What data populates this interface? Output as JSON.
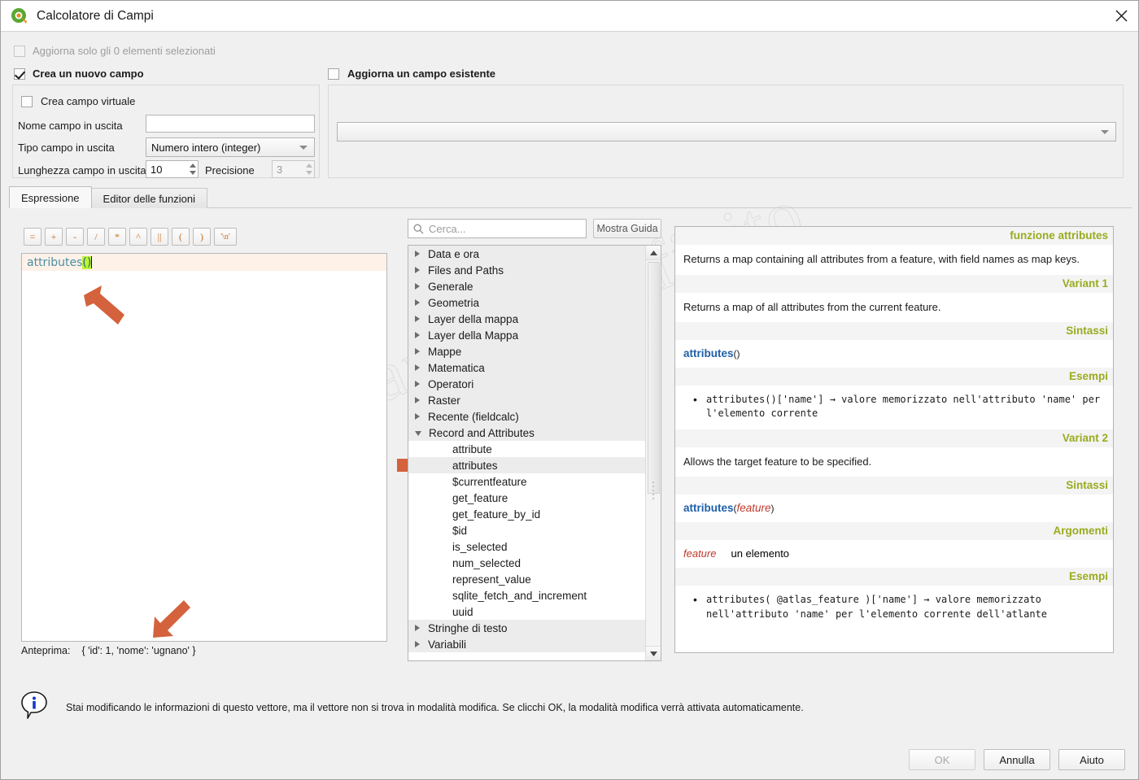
{
  "window": {
    "title": "Calcolatore di Campi",
    "logo_icon": "qgis-logo-icon",
    "close_icon": "close-icon"
  },
  "top": {
    "update_selected_label": "Aggiorna solo gli 0 elementi selezionati",
    "create_new_field_label": "Crea un nuovo campo",
    "update_existing_field_label": "Aggiorna un campo esistente",
    "virtual_field_label": "Crea campo virtuale",
    "output_name_label": "Nome campo in uscita",
    "output_name_value": "",
    "output_type_label": "Tipo campo in uscita",
    "output_type_value": "Numero intero (integer)",
    "output_length_label": "Lunghezza campo in uscita",
    "output_length_value": "10",
    "precision_label": "Precisione",
    "precision_value": "3",
    "existing_field_value": ""
  },
  "tabs": [
    {
      "label": "Espressione",
      "active": true
    },
    {
      "label": "Editor delle funzioni",
      "active": false
    }
  ],
  "operators": [
    "=",
    "+",
    "-",
    "/",
    "*",
    "^",
    "||",
    "(",
    ")",
    "'\\n'"
  ],
  "expression": {
    "function_token": "attributes",
    "open_paren": "( ",
    "close_paren": ")"
  },
  "preview": {
    "label": "Anteprima:",
    "value": "{ 'id': 1, 'nome': 'ugnano' }"
  },
  "search": {
    "placeholder": "Cerca...",
    "value": "",
    "icon": "search-icon",
    "help_button": "Mostra Guida"
  },
  "tree": [
    {
      "label": "Data e ora",
      "type": "group",
      "expanded": false
    },
    {
      "label": "Files and Paths",
      "type": "group",
      "expanded": false
    },
    {
      "label": "Generale",
      "type": "group",
      "expanded": false
    },
    {
      "label": "Geometria",
      "type": "group",
      "expanded": false
    },
    {
      "label": "Layer della mappa",
      "type": "group",
      "expanded": false
    },
    {
      "label": "Layer della Mappa",
      "type": "group",
      "expanded": false
    },
    {
      "label": "Mappe",
      "type": "group",
      "expanded": false
    },
    {
      "label": "Matematica",
      "type": "group",
      "expanded": false
    },
    {
      "label": "Operatori",
      "type": "group",
      "expanded": false
    },
    {
      "label": "Raster",
      "type": "group",
      "expanded": false
    },
    {
      "label": "Recente (fieldcalc)",
      "type": "group",
      "expanded": false
    },
    {
      "label": "Record and Attributes",
      "type": "group",
      "expanded": true
    },
    {
      "label": "attribute",
      "type": "leaf",
      "selected": false
    },
    {
      "label": "attributes",
      "type": "leaf",
      "selected": true
    },
    {
      "label": "$currentfeature",
      "type": "leaf",
      "selected": false
    },
    {
      "label": "get_feature",
      "type": "leaf",
      "selected": false
    },
    {
      "label": "get_feature_by_id",
      "type": "leaf",
      "selected": false
    },
    {
      "label": "$id",
      "type": "leaf",
      "selected": false
    },
    {
      "label": "is_selected",
      "type": "leaf",
      "selected": false
    },
    {
      "label": "num_selected",
      "type": "leaf",
      "selected": false
    },
    {
      "label": "represent_value",
      "type": "leaf",
      "selected": false
    },
    {
      "label": "sqlite_fetch_and_increment",
      "type": "leaf",
      "selected": false
    },
    {
      "label": "uuid",
      "type": "leaf",
      "selected": false
    },
    {
      "label": "Stringhe di testo",
      "type": "group",
      "expanded": false
    },
    {
      "label": "Variabili",
      "type": "group",
      "expanded": false
    }
  ],
  "help": {
    "title": "funzione attributes",
    "intro": "Returns a map containing all attributes from a feature, with field names as map keys.",
    "variant1_head": "Variant 1",
    "variant1_desc": "Returns a map of all attributes from the current feature.",
    "syntax_head": "Sintassi",
    "variant1_syntax_fn": "attributes",
    "variant1_syntax_args": "()",
    "examples_head": "Esempi",
    "variant1_example": "attributes()['name'] → valore memorizzato nell'attributo 'name' per l'elemento corrente",
    "variant2_head": "Variant 2",
    "variant2_desc": "Allows the target feature to be specified.",
    "variant2_syntax_fn": "attributes",
    "variant2_syntax_open": "(",
    "variant2_syntax_arg": "feature",
    "variant2_syntax_close": ")",
    "arguments_head": "Argomenti",
    "argument_name": "feature",
    "argument_desc": "un elemento",
    "variant2_example": "attributes( @atlas_feature )['name'] → valore memorizzato nell'attributo 'name' per l'elemento corrente dell'atlante"
  },
  "footer": {
    "info_icon": "info-icon",
    "message": "Stai modificando le informazioni di questo vettore, ma il vettore non si trova in modalità modifica. Se clicchi OK, la modalità modifica verrà attivata automaticamente.",
    "buttons": [
      {
        "label": "OK",
        "disabled": true
      },
      {
        "label": "Annulla",
        "disabled": false
      },
      {
        "label": "Aiuto",
        "disabled": false
      }
    ]
  },
  "watermark": {
    "text": "Digimappeacoinfinito"
  },
  "colors": {
    "accent_orange": "#d4623c",
    "help_heading": "#9aab1f",
    "function_blue": "#1f5fa9",
    "arg_red": "#c0392b",
    "expr_highlight": "#bff230"
  }
}
